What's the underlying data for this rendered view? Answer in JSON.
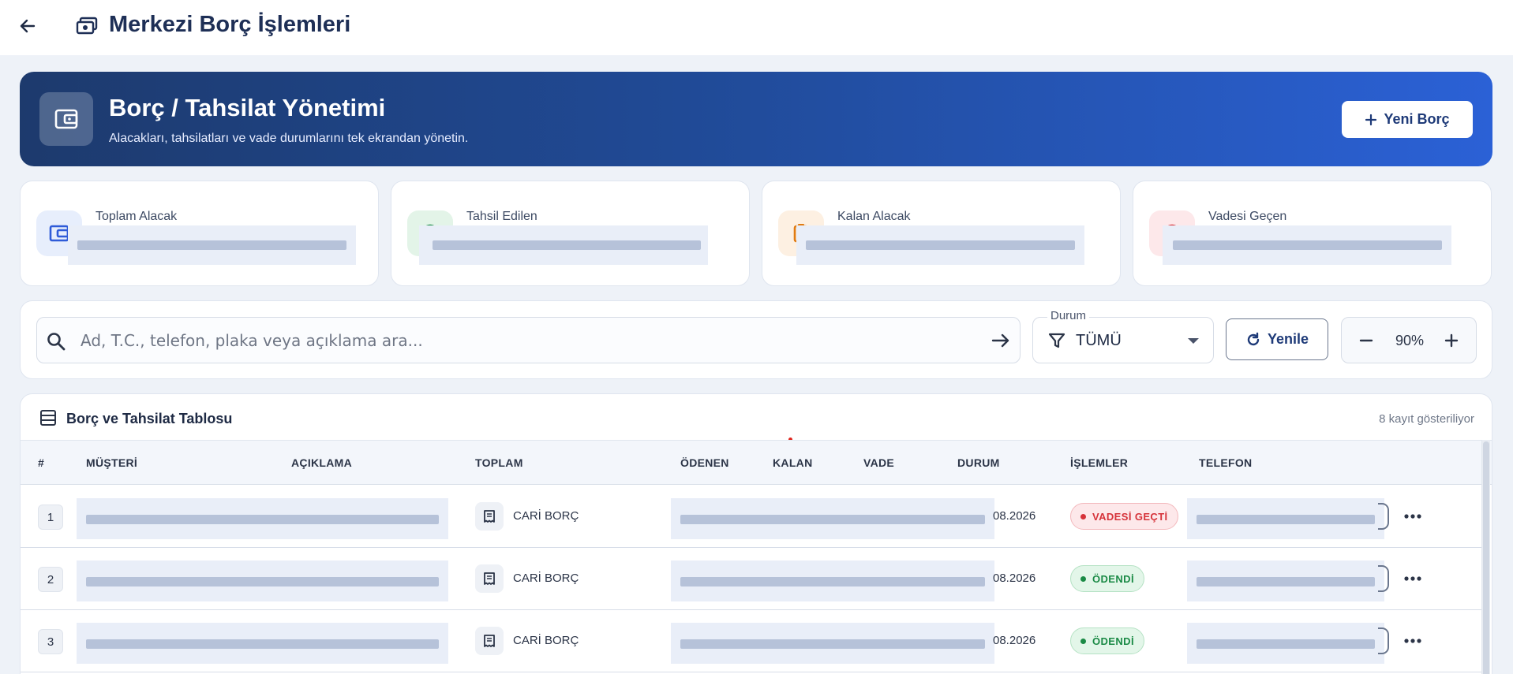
{
  "header": {
    "title": "Merkezi Borç İşlemleri",
    "back_icon": "arrow-left-icon",
    "title_icon": "money-icon"
  },
  "hero": {
    "title": "Borç / Tahsilat Yönetimi",
    "subtitle": "Alacakları, tahsilatları ve vade durumlarını tek ekrandan yönetin.",
    "icon": "wallet-icon",
    "new_button": "Yeni Borç"
  },
  "stats": [
    {
      "label": "Toplam Alacak",
      "icon": "wallet-icon",
      "color": "#2f5bd8",
      "bg": "#e7eefc"
    },
    {
      "label": "Tahsil Edilen",
      "icon": "check-circle-icon",
      "color": "#1a8a45",
      "bg": "#e3f4e8"
    },
    {
      "label": "Kalan Alacak",
      "icon": "clipboard-icon",
      "color": "#e07b12",
      "bg": "#fdf0e2"
    },
    {
      "label": "Vadesi Geçen",
      "icon": "alert-icon",
      "color": "#d6333a",
      "bg": "#fde8ea"
    }
  ],
  "filters": {
    "search_placeholder": "Ad, T.C., telefon, plaka veya açıklama ara...",
    "status_label": "Durum",
    "status_value": "TÜMÜ",
    "refresh_label": "Yenile",
    "zoom_value": "90%"
  },
  "table": {
    "title": "Borç ve Tahsilat Tablosu",
    "record_count": "8 kayıt gösteriliyor",
    "columns": [
      "#",
      "MÜŞTERİ",
      "AÇIKLAMA",
      "TOPLAM",
      "ÖDENEN",
      "KALAN",
      "VADE",
      "DURUM",
      "İŞLEMLER",
      "TELEFON"
    ],
    "rows": [
      {
        "num": "1",
        "type": "CARİ BORÇ",
        "date_tail": "08.2026",
        "status": "VADESİ GEÇTİ",
        "status_color": "#d6333a",
        "status_bg": "#fde8ea",
        "status_border": "#f3b9bd"
      },
      {
        "num": "2",
        "type": "CARİ BORÇ",
        "date_tail": "08.2026",
        "status": "ÖDENDİ",
        "status_color": "#1a8a45",
        "status_bg": "#e3f6e9",
        "status_border": "#b5e2c4"
      },
      {
        "num": "3",
        "type": "CARİ BORÇ",
        "date_tail": "08.2026",
        "status": "ÖDENDİ",
        "status_color": "#1a8a45",
        "status_bg": "#e3f6e9",
        "status_border": "#b5e2c4"
      }
    ]
  }
}
